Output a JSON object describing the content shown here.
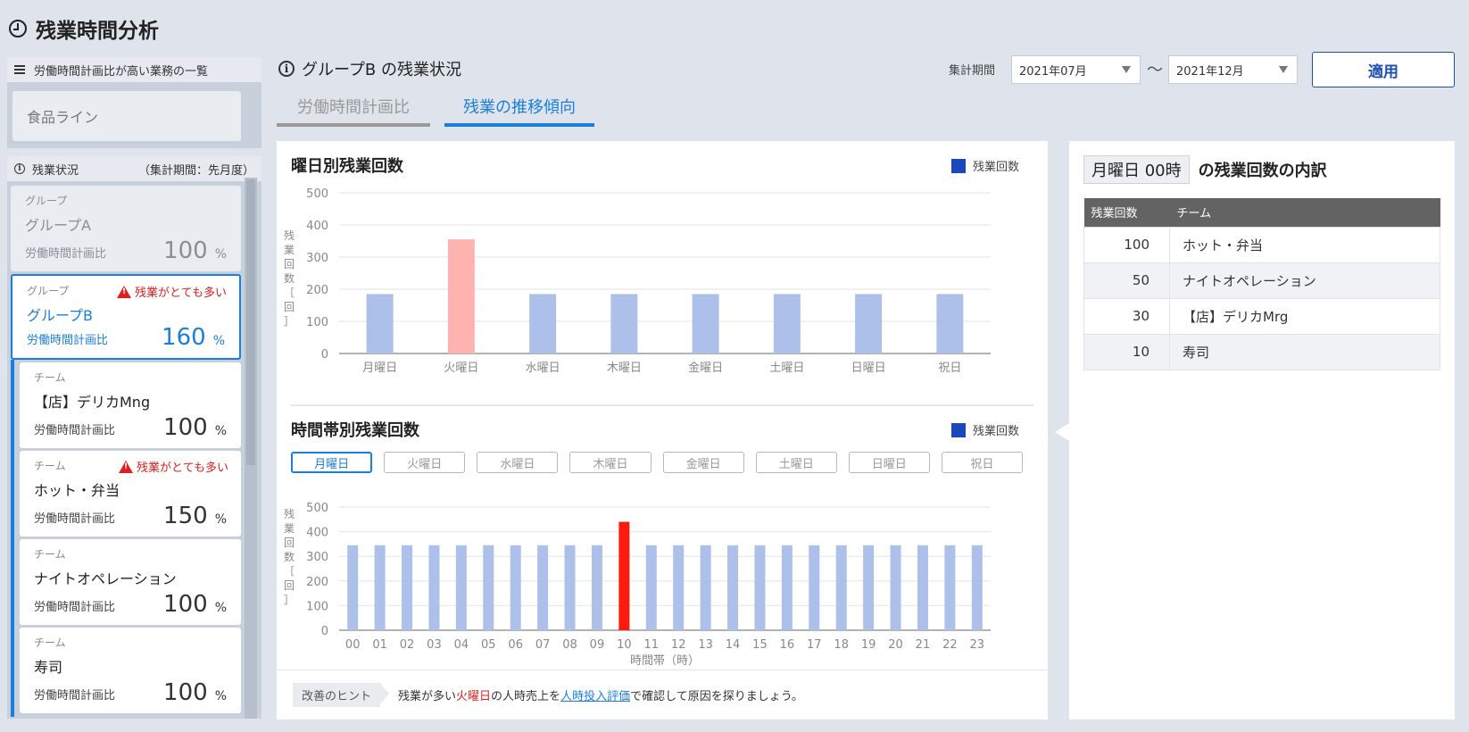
{
  "page": {
    "title": "残業時間分析"
  },
  "sidebar": {
    "plan_list_title": "労働時間計画比が高い業務の一覧",
    "plan_list_items": [
      "食品ライン"
    ],
    "status_title": "残業状況",
    "status_period": "（集計期間：先月度）",
    "cards": [
      {
        "kind": "グループ",
        "name": "グループA",
        "ratio_label": "労働時間計画比",
        "ratio": "100",
        "unit": "%",
        "warning": ""
      },
      {
        "kind": "グループ",
        "name": "グループB",
        "ratio_label": "労働時間計画比",
        "ratio": "160",
        "unit": "%",
        "warning": "残業がとても多い"
      },
      {
        "kind": "チーム",
        "name": "【店】デリカMng",
        "ratio_label": "労働時間計画比",
        "ratio": "100",
        "unit": "%",
        "warning": ""
      },
      {
        "kind": "チーム",
        "name": "ホット・弁当",
        "ratio_label": "労働時間計画比",
        "ratio": "150",
        "unit": "%",
        "warning": "残業がとても多い"
      },
      {
        "kind": "チーム",
        "name": "ナイトオペレーション",
        "ratio_label": "労働時間計画比",
        "ratio": "100",
        "unit": "%",
        "warning": ""
      },
      {
        "kind": "チーム",
        "name": "寿司",
        "ratio_label": "労働時間計画比",
        "ratio": "100",
        "unit": "%",
        "warning": ""
      }
    ]
  },
  "main": {
    "title": "グループB の残業状況",
    "period_label": "集計期間",
    "period_from": "2021年07月",
    "tilde": "〜",
    "period_to": "2021年12月",
    "apply_label": "適用",
    "tabs": [
      {
        "label": "労働時間計画比",
        "active": false
      },
      {
        "label": "残業の推移傾向",
        "active": true
      }
    ],
    "day_buttons": [
      "月曜日",
      "火曜日",
      "水曜日",
      "木曜日",
      "金曜日",
      "土曜日",
      "日曜日",
      "祝日"
    ],
    "hint": {
      "tag": "改善のヒント",
      "text1": "残業が多い",
      "red": "火曜日",
      "text2": "の人時売上を",
      "link": "人時投入評価",
      "text3": "で確認して原因を探りましょう。"
    }
  },
  "chart_data": [
    {
      "type": "bar",
      "title": "曜日別残業回数",
      "legend": "残業回数",
      "ylabel": "残業回数［回］",
      "xlabel": "",
      "ylim": [
        0,
        500
      ],
      "yticks": [
        0,
        100,
        200,
        300,
        400,
        500
      ],
      "categories": [
        "月曜日",
        "火曜日",
        "水曜日",
        "木曜日",
        "金曜日",
        "土曜日",
        "日曜日",
        "祝日"
      ],
      "values": [
        185,
        355,
        185,
        185,
        185,
        185,
        185,
        185
      ],
      "highlight_index": 1,
      "colors": {
        "normal": "#adc0ea",
        "highlight": "#ffb3b0",
        "legend": "#1b47b8"
      }
    },
    {
      "type": "bar",
      "title": "時間帯別残業回数",
      "legend": "残業回数",
      "ylabel": "残業回数［回］",
      "xlabel": "時間帯（時）",
      "ylim": [
        0,
        500
      ],
      "yticks": [
        0,
        100,
        200,
        300,
        400,
        500
      ],
      "categories": [
        "00",
        "01",
        "02",
        "03",
        "04",
        "05",
        "06",
        "07",
        "08",
        "09",
        "10",
        "11",
        "12",
        "13",
        "14",
        "15",
        "16",
        "17",
        "18",
        "19",
        "20",
        "21",
        "22",
        "23"
      ],
      "values": [
        345,
        345,
        345,
        345,
        345,
        345,
        345,
        345,
        345,
        345,
        440,
        345,
        345,
        345,
        345,
        345,
        345,
        345,
        345,
        345,
        345,
        345,
        345,
        345
      ],
      "highlight_index": 10,
      "colors": {
        "normal": "#adc0ea",
        "highlight": "#ff1a0f",
        "legend": "#1b47b8"
      }
    }
  ],
  "breakdown": {
    "tag": "月曜日 00時",
    "title": "の残業回数の内訳",
    "columns": [
      "残業回数",
      "チーム"
    ],
    "rows": [
      {
        "count": "100",
        "team": "ホット・弁当"
      },
      {
        "count": "50",
        "team": "ナイトオペレーション"
      },
      {
        "count": "30",
        "team": "【店】デリカMrg"
      },
      {
        "count": "10",
        "team": "寿司"
      }
    ]
  }
}
